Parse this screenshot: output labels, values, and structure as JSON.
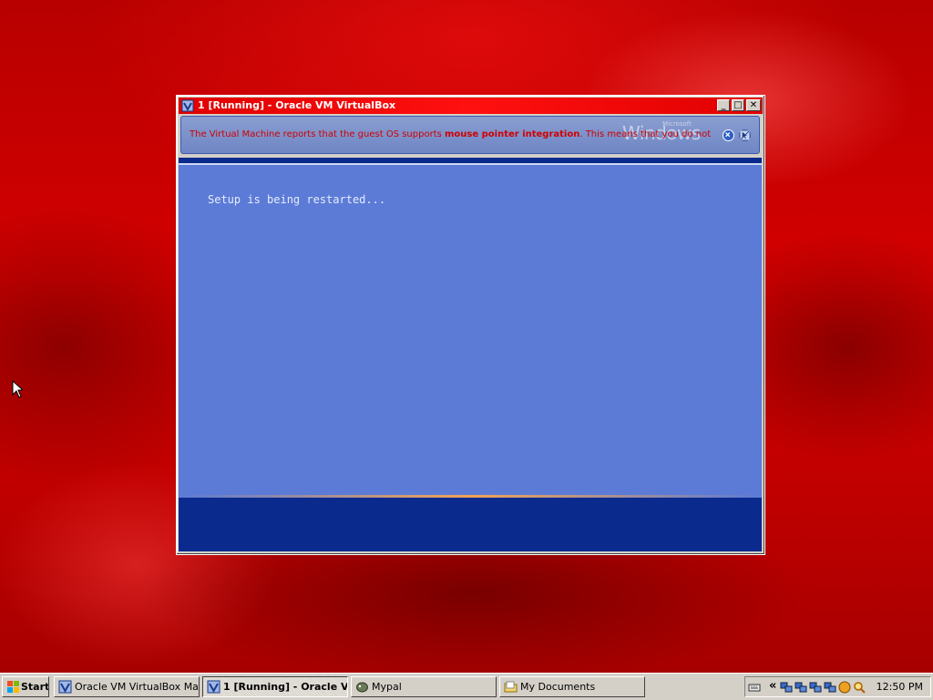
{
  "window": {
    "title": "1 [Running] - Oracle VM VirtualBox",
    "minimize_label": "_",
    "maximize_label": "□",
    "close_label": "✕"
  },
  "notification": {
    "text_before": "The Virtual Machine reports that the guest OS supports ",
    "text_bold": "mouse pointer integration",
    "text_after": ". This means that you do not",
    "text_color": "#d00000",
    "logo_text": "Windows",
    "logo_small": "Microsoft"
  },
  "guest": {
    "message": "Setup is being restarted...",
    "background_color": "#5b7bd6",
    "bar_color": "#0b2a8e"
  },
  "taskbar": {
    "start_label": "Start",
    "tasks": [
      {
        "label": "Oracle VM VirtualBox Ma...",
        "icon": "virtualbox-icon",
        "active": false
      },
      {
        "label": "1 [Running] - Oracle V...",
        "icon": "virtualbox-icon",
        "active": true
      },
      {
        "label": "Mypal",
        "icon": "mypal-icon",
        "active": false
      },
      {
        "label": "My Documents",
        "icon": "folder-icon",
        "active": false
      }
    ],
    "tray_chevron": "«",
    "clock": "12:50 PM"
  },
  "colors": {
    "titlebar": "#ff1010",
    "desktop": "#c00000"
  }
}
